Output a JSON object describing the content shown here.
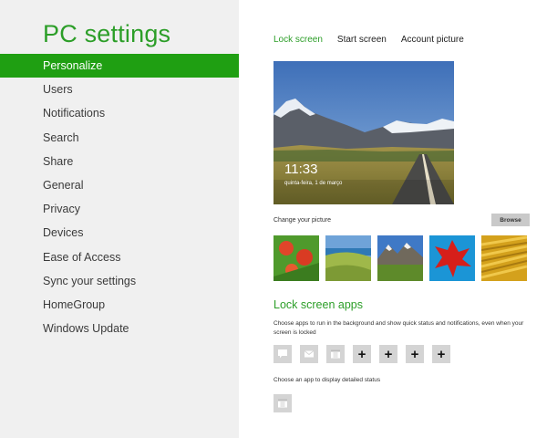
{
  "app": {
    "title": "PC settings"
  },
  "sidebar": {
    "items": [
      {
        "label": "Personalize",
        "active": true
      },
      {
        "label": "Users"
      },
      {
        "label": "Notifications"
      },
      {
        "label": "Search"
      },
      {
        "label": "Share"
      },
      {
        "label": "General"
      },
      {
        "label": "Privacy"
      },
      {
        "label": "Devices"
      },
      {
        "label": "Ease of Access"
      },
      {
        "label": "Sync your settings"
      },
      {
        "label": "HomeGroup"
      },
      {
        "label": "Windows Update"
      }
    ]
  },
  "tabs": [
    {
      "label": "Lock screen",
      "active": true
    },
    {
      "label": "Start screen"
    },
    {
      "label": "Account picture"
    }
  ],
  "lock_preview": {
    "time": "11:33",
    "date": "quinta-feira, 1 de março"
  },
  "change_picture": {
    "label": "Change your picture",
    "browse_label": "Browse"
  },
  "thumbnails": [
    "flowers",
    "coast-hills",
    "mountain-valley",
    "red-leaf",
    "golden-grass"
  ],
  "lock_apps": {
    "title": "Lock screen apps",
    "description": "Choose apps to run in the background and show quick status and notifications, even when your screen is locked",
    "slots": [
      {
        "icon": "messaging-icon"
      },
      {
        "icon": "mail-icon"
      },
      {
        "icon": "calendar-icon"
      },
      {
        "icon": "plus-icon",
        "label": "+"
      },
      {
        "icon": "plus-icon",
        "label": "+"
      },
      {
        "icon": "plus-icon",
        "label": "+"
      },
      {
        "icon": "plus-icon",
        "label": "+"
      }
    ],
    "detail_label": "Choose an app to display detailed status",
    "detail_slot": {
      "icon": "calendar-icon"
    }
  },
  "colors": {
    "accent": "#2c9e28",
    "active_bg": "#1f9f12",
    "sidebar_bg": "#f0f0f0",
    "slot_bg": "#d4d4d4"
  }
}
